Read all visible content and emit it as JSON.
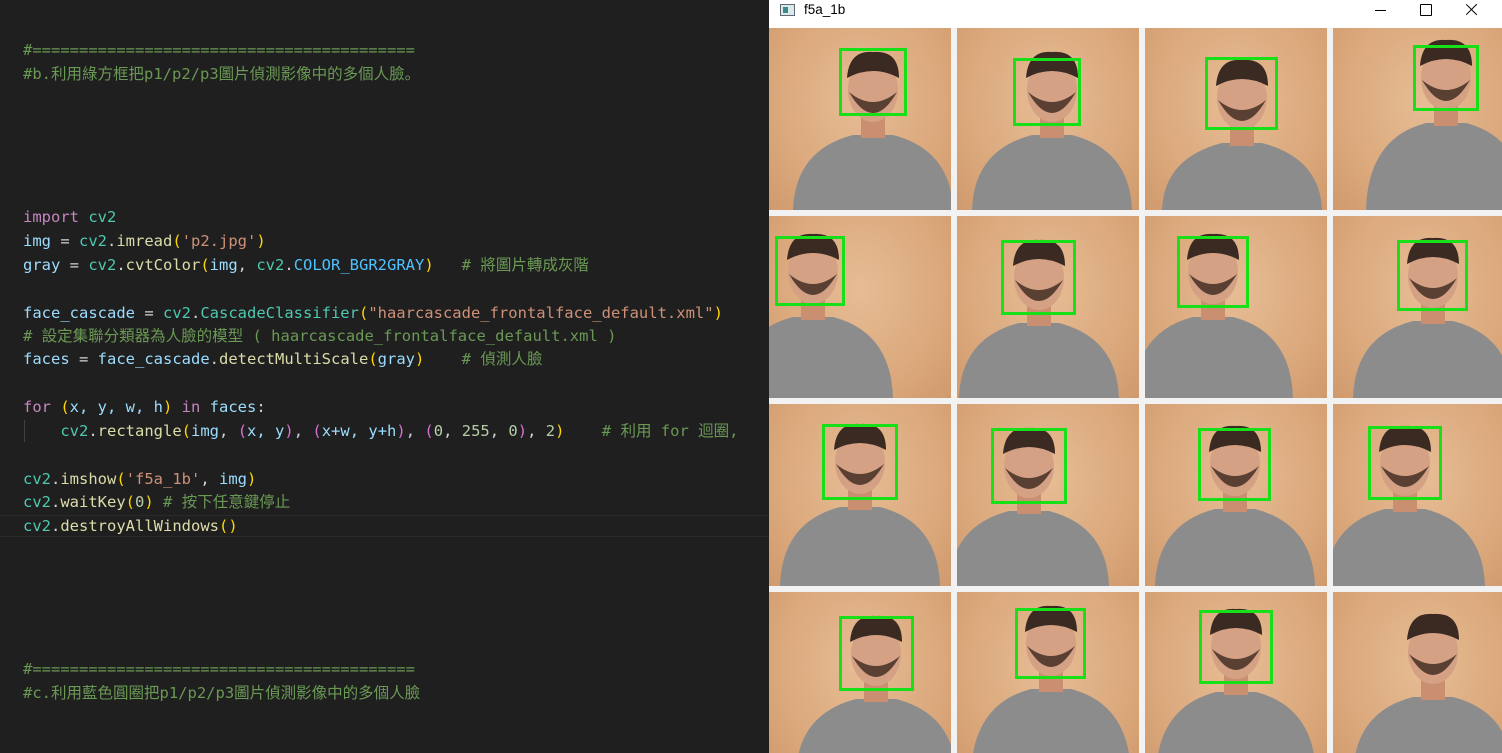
{
  "editor": {
    "lines": [
      {
        "type": "comment",
        "text": "#========================================="
      },
      {
        "type": "comment",
        "text": "#b.利用綠方框把p1/p2/p3圖片偵測影像中的多個人臉。"
      },
      {
        "type": "comment",
        "text": "#========================================="
      },
      {
        "type": "comment",
        "text": "#c.利用藍色圓圈把p1/p2/p3圖片偵測影像中的多個人臉"
      }
    ],
    "code": {
      "l1": {
        "kw": "import",
        "mod": "cv2"
      },
      "l2": {
        "var": "img",
        "eq": " = ",
        "mod": "cv2",
        "dot": ".",
        "fn": "imread",
        "open": "(",
        "str": "'p2.jpg'",
        "close": ")"
      },
      "l3": {
        "var": "gray",
        "eq": " = ",
        "mod": "cv2",
        "dot": ".",
        "fn": "cvtColor",
        "open": "(",
        "a1": "img",
        "comma": ", ",
        "mod2": "cv2",
        "dot2": ".",
        "cst": "COLOR_BGR2GRAY",
        "close": ")",
        "comment": "   # 將圖片轉成灰階"
      },
      "l4": {
        "var": "face_cascade",
        "eq": " = ",
        "mod": "cv2",
        "dot": ".",
        "fn": "CascadeClassifier",
        "open": "(",
        "str": "\"haarcascade_frontalface_default.xml\"",
        "close": ")"
      },
      "l5": {
        "comment": "# 設定集聯分類器為人臉的模型 ( haarcascade_frontalface_default.xml )"
      },
      "l6": {
        "var": "faces",
        "eq": " = ",
        "obj": "face_cascade",
        "dot": ".",
        "fn": "detectMultiScale",
        "open": "(",
        "arg": "gray",
        "close": ")",
        "comment": "    # 偵測人臉"
      },
      "l7": {
        "kw": "for",
        "open": " (",
        "args": "x, y, w, h",
        "close": ")",
        "kw2": " in ",
        "var": "faces",
        "colon": ":"
      },
      "l8": {
        "indent": "    ",
        "mod": "cv2",
        "dot": ".",
        "fn": "rectangle",
        "open": "(",
        "a1": "img",
        "c1": ", ",
        "t1o": "(",
        "t1": "x, y",
        "t1c": ")",
        "c2": ", ",
        "t2o": "(",
        "t2": "x+w, y+h",
        "t2c": ")",
        "c3": ", ",
        "t3o": "(",
        "n1": "0",
        "c4": ", ",
        "n2": "255",
        "c5": ", ",
        "n3": "0",
        "t3c": ")",
        "c6": ", ",
        "n4": "2",
        "close": ")",
        "comment": "    # 利用 for 迴圈,"
      },
      "l9": {
        "mod": "cv2",
        "dot": ".",
        "fn": "imshow",
        "open": "(",
        "str": "'f5a_1b'",
        "comma": ", ",
        "a1": "img",
        "close": ")"
      },
      "l10": {
        "mod": "cv2",
        "dot": ".",
        "fn": "waitKey",
        "open": "(",
        "num": "0",
        "close": ")",
        "comment": " # 按下任意鍵停止"
      },
      "l11": {
        "mod": "cv2",
        "dot": ".",
        "fn": "destroyAllWindows",
        "open": "(",
        "close": ")"
      }
    }
  },
  "window": {
    "title": "f5a_1b",
    "icon": "app-window-icon",
    "controls": [
      "minimize-icon",
      "maximize-icon",
      "close-icon"
    ],
    "box_color": "#18e018",
    "tiles_with_face_box": 15,
    "tiles_total": 16
  }
}
